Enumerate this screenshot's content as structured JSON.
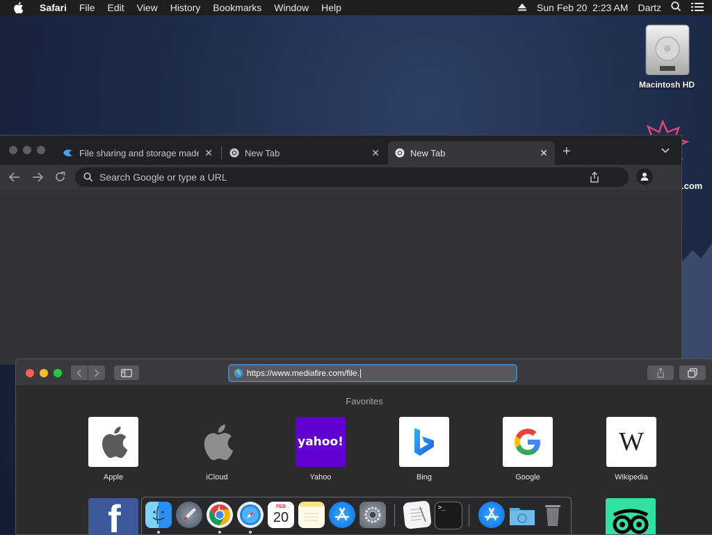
{
  "menubar": {
    "app_name": "Safari",
    "items": [
      "File",
      "Edit",
      "View",
      "History",
      "Bookmarks",
      "Window",
      "Help"
    ],
    "datetime": "Sun Feb 20  2:23 AM",
    "user": "Dartz"
  },
  "desktop": {
    "hd_label": "Macintosh HD",
    "partial_label": ".com"
  },
  "chrome": {
    "tabs": [
      {
        "title": "File sharing and storage made simple",
        "icon": "mediafire-icon"
      },
      {
        "title": "New Tab",
        "icon": "chrome-icon"
      },
      {
        "title": "New Tab",
        "icon": "chrome-icon",
        "active": true
      }
    ],
    "omnibox_placeholder": "Search Google or type a URL"
  },
  "safari": {
    "url": "https://www.mediafire.com/file.",
    "favorites_title": "Favorites",
    "favorites": [
      {
        "label": "Apple"
      },
      {
        "label": "iCloud"
      },
      {
        "label": "Yahoo",
        "tile_text": "yahoo!"
      },
      {
        "label": "Bing"
      },
      {
        "label": "Google"
      },
      {
        "label": "Wikipedia",
        "tile_text": "W"
      }
    ]
  },
  "dock": {
    "calendar_month": "FEB",
    "calendar_day": "20",
    "apps": [
      "Finder",
      "Launchpad",
      "Chrome",
      "Safari",
      "Calendar",
      "Notes",
      "App Store",
      "System Preferences",
      "TextEdit",
      "Terminal",
      "App Store",
      "Downloads",
      "Trash"
    ]
  },
  "colors": {
    "menubar": "#1e1e1e",
    "chrome_tabstrip": "#202124",
    "safari_toolbar": "#3a3a3c",
    "url_focus": "#3b82c4",
    "yahoo_purple": "#6001d2"
  }
}
